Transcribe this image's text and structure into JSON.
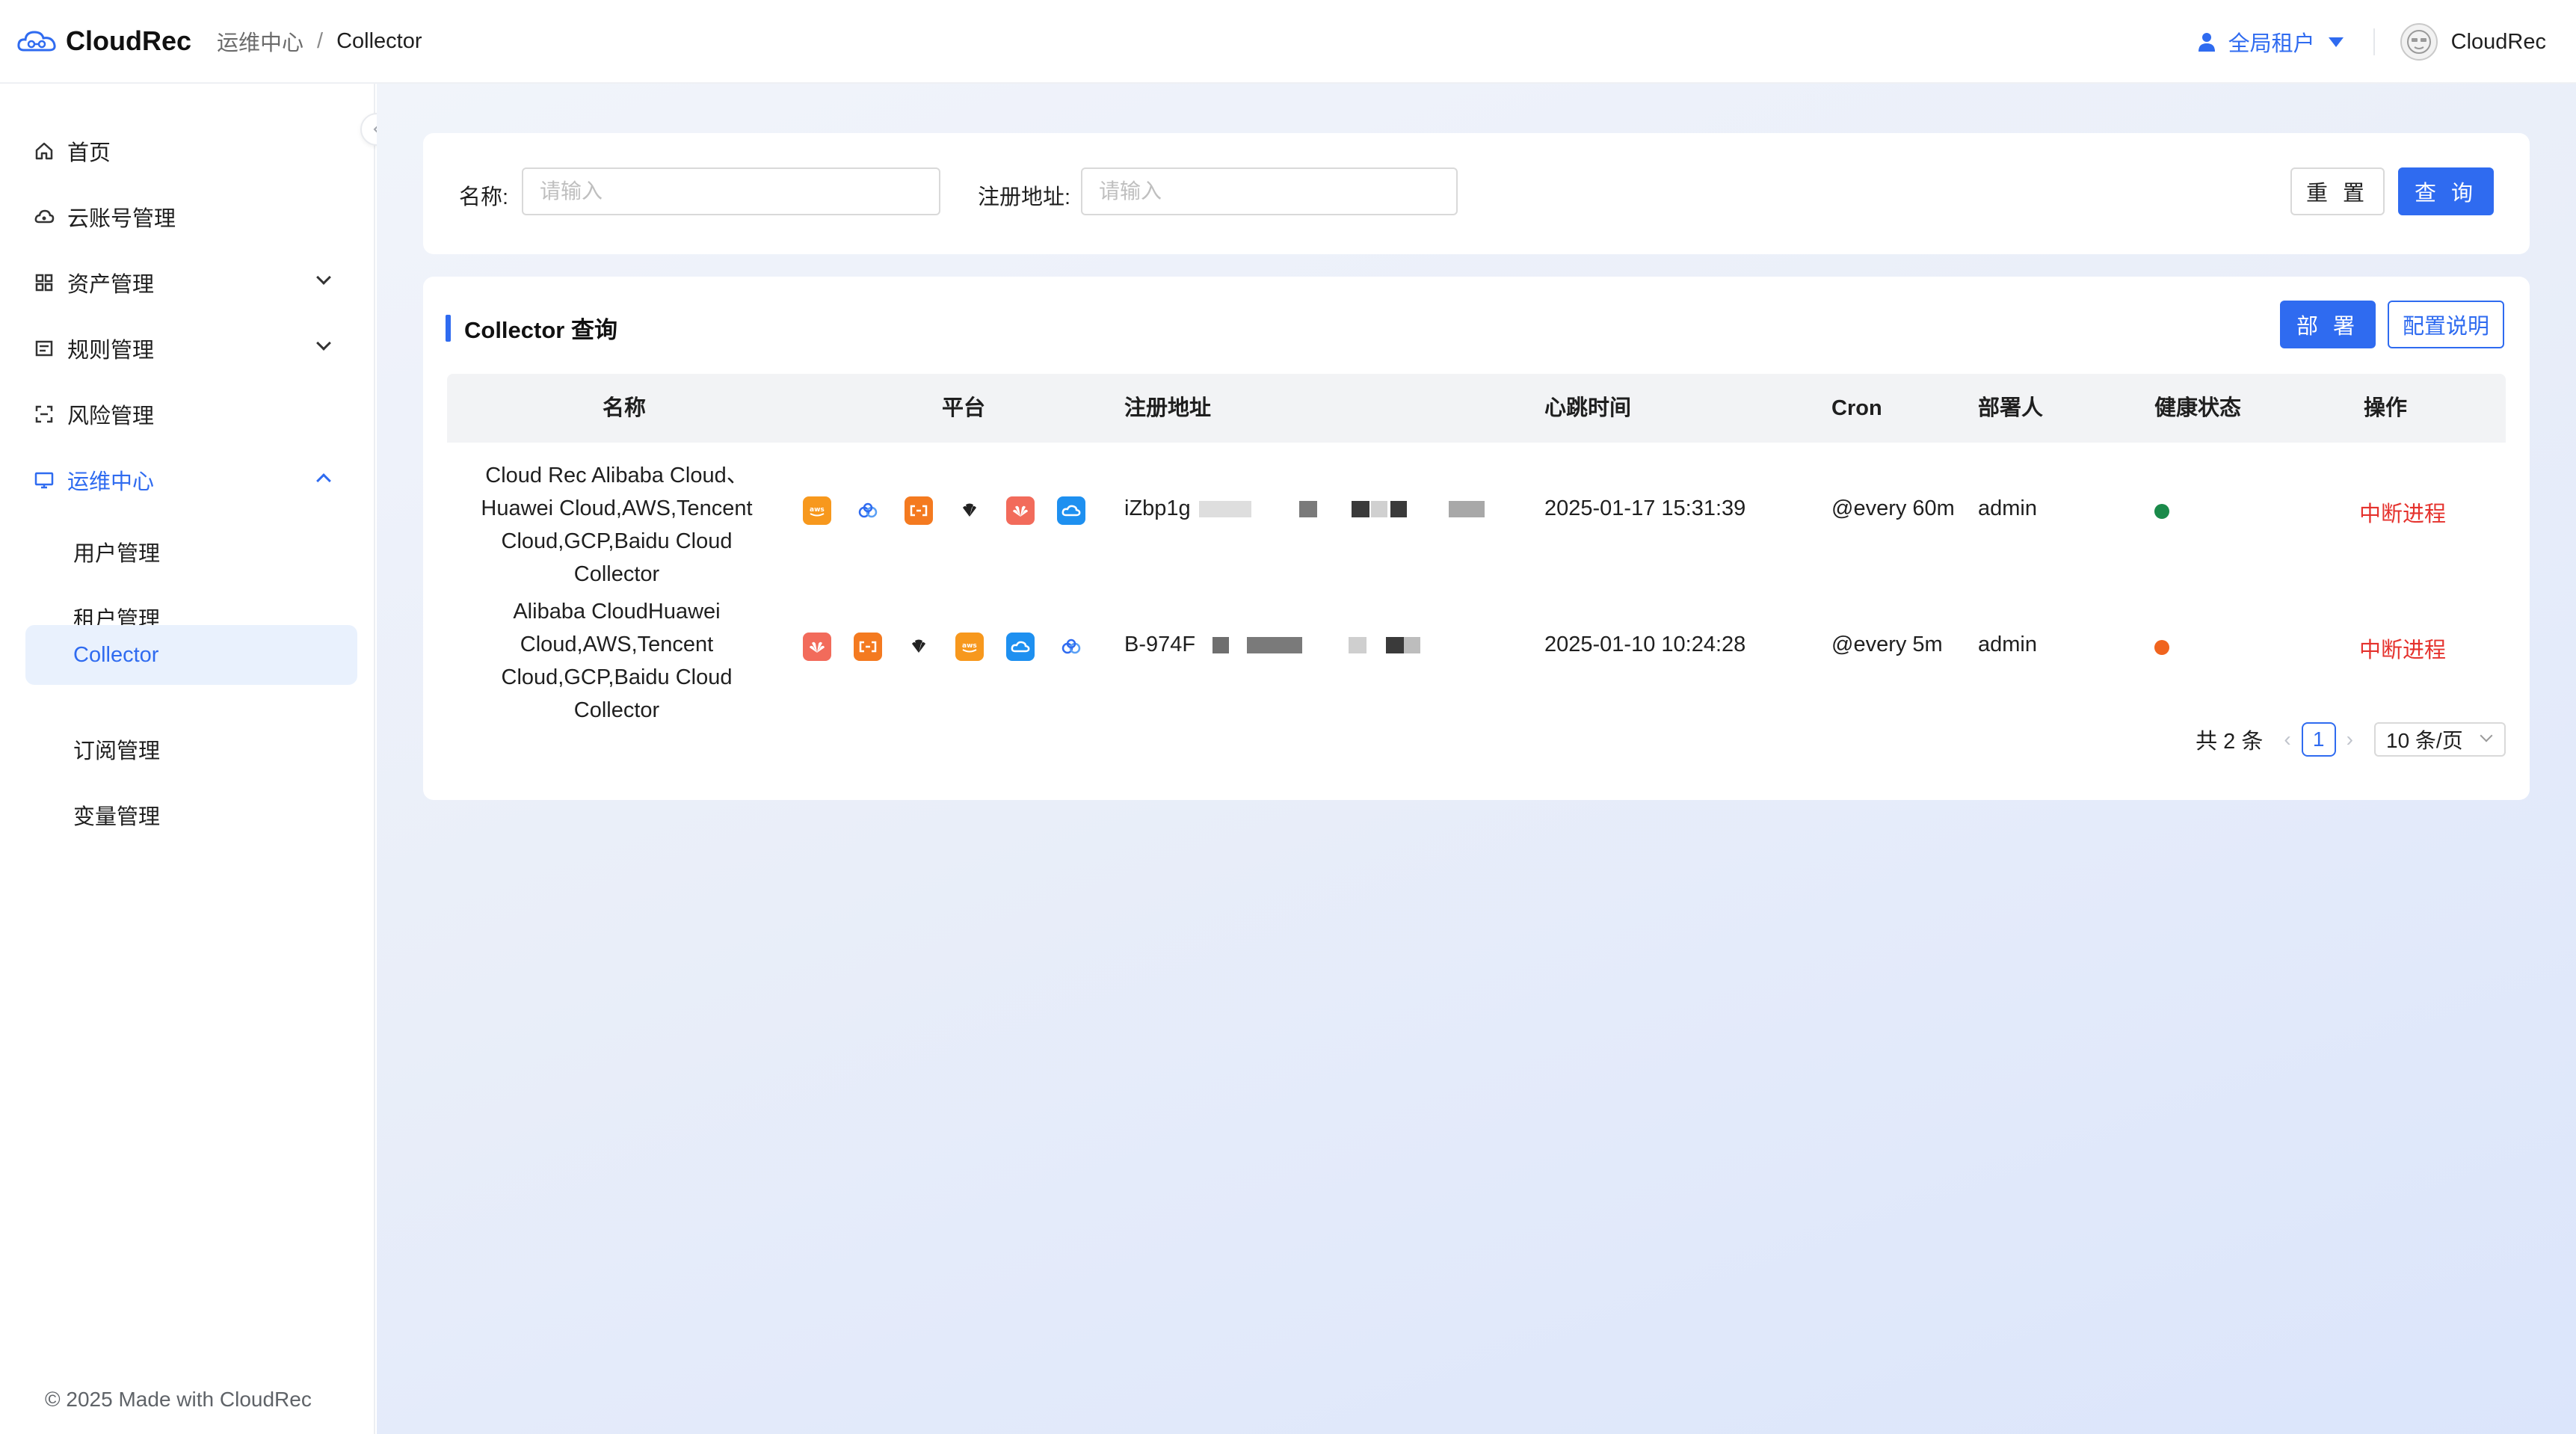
{
  "header": {
    "logo_text": "CloudRec",
    "breadcrumb": {
      "parent": "运维中心",
      "separator": "/",
      "current": "Collector"
    },
    "tenant_label": "全局租户",
    "user_name": "CloudRec"
  },
  "sidebar": {
    "items": [
      {
        "label": "首页",
        "icon": "home-icon"
      },
      {
        "label": "云账号管理",
        "icon": "cloud-account-icon"
      },
      {
        "label": "资产管理",
        "icon": "asset-icon",
        "expandable": true
      },
      {
        "label": "规则管理",
        "icon": "rule-icon",
        "expandable": true
      },
      {
        "label": "风险管理",
        "icon": "risk-icon"
      },
      {
        "label": "运维中心",
        "icon": "monitor-icon",
        "expanded": true,
        "active": true
      }
    ],
    "sub_items": [
      {
        "label": "用户管理"
      },
      {
        "label": "租户管理"
      },
      {
        "label": "Collector",
        "selected": true
      },
      {
        "label": "订阅管理"
      },
      {
        "label": "变量管理"
      }
    ],
    "footer": "© 2025 Made with CloudRec"
  },
  "search": {
    "name_label": "名称:",
    "name_placeholder": "请输入",
    "address_label": "注册地址:",
    "address_placeholder": "请输入",
    "reset_label": "重 置",
    "query_label": "查 询"
  },
  "table": {
    "title": "Collector 查询",
    "deploy_label": "部 署",
    "config_label": "配置说明",
    "columns": [
      "名称",
      "平台",
      "注册地址",
      "心跳时间",
      "Cron",
      "部署人",
      "健康状态",
      "操作"
    ],
    "rows": [
      {
        "name_lines": [
          "Cloud Rec Alibaba Cloud、",
          "Huawei Cloud,AWS,Tencent",
          "Cloud,GCP,Baidu Cloud Collector"
        ],
        "platforms": [
          "aws-icon",
          "baidu-cloud-icon",
          "alibaba-cloud-icon",
          "gcp-icon",
          "huawei-cloud-icon",
          "tencent-cloud-icon"
        ],
        "address": "iZbp1g",
        "heartbeat": "2025-01-17 15:31:39",
        "cron": "@every 60m",
        "deployer": "admin",
        "health_color": "#1a8a4a",
        "operation": "中断进程"
      },
      {
        "name_lines": [
          "Alibaba CloudHuawei",
          "Cloud,AWS,Tencent",
          "Cloud,GCP,Baidu Cloud Collector"
        ],
        "platforms": [
          "huawei-cloud-icon",
          "alibaba-cloud-icon",
          "gcp-icon",
          "aws-icon",
          "tencent-cloud-icon",
          "baidu-cloud-icon"
        ],
        "address": "B-974F",
        "heartbeat": "2025-01-10 10:24:28",
        "cron": "@every 5m",
        "deployer": "admin",
        "health_color": "#f0641e",
        "operation": "中断进程"
      }
    ]
  },
  "pagination": {
    "total_text": "共 2 条",
    "current_page": "1",
    "page_size": "10 条/页"
  },
  "colors": {
    "accent": "#2f6bf0",
    "danger": "#e5322d"
  }
}
